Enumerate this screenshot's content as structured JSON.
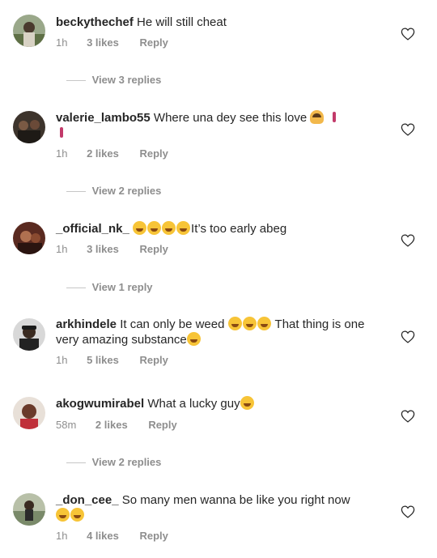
{
  "comments": [
    {
      "username": "beckythechef",
      "text": "He will still cheat",
      "time": "1h",
      "likes": "3 likes",
      "reply": "Reply",
      "replies": "View 3 replies",
      "avatar_color": "#6a7a58"
    },
    {
      "username": "valerie_lambo55",
      "text": "Where una dey see this love",
      "time": "1h",
      "likes": "2 likes",
      "reply": "Reply",
      "replies": "View 2 replies",
      "avatar_color": "#3d342c"
    },
    {
      "username": "_official_nk_",
      "text_after": "It’s too early abeg",
      "time": "1h",
      "likes": "3 likes",
      "reply": "Reply",
      "replies": "View 1 reply",
      "avatar_color": "#5a2a20"
    },
    {
      "username": "arkhindele",
      "text": "It can only be weed",
      "text_after": "That thing is one very amazing substance",
      "time": "1h",
      "likes": "5 likes",
      "reply": "Reply",
      "avatar_color": "#2a2a2a"
    },
    {
      "username": "akogwumirabel",
      "text": "What a lucky guy",
      "time": "58m",
      "likes": "2 likes",
      "reply": "Reply",
      "replies": "View 2 replies",
      "avatar_color": "#6a3a2a"
    },
    {
      "username": "_don_cee_",
      "text": "So many men wanna be like you right now",
      "time": "1h",
      "likes": "4 likes",
      "reply": "Reply",
      "avatar_color": "#8a9a7a"
    }
  ],
  "icons": {
    "heart": "heart-outline-icon",
    "laugh": "face-with-tears-of-joy-icon",
    "woman": "person-gesturing-no-icon",
    "walk": "person-walking-icon",
    "rofl": "rolling-on-floor-laughing-icon",
    "zipper": "zipper-mouth-face-icon"
  },
  "colors": {
    "text": "#262626",
    "secondary": "#8e8e8e"
  }
}
